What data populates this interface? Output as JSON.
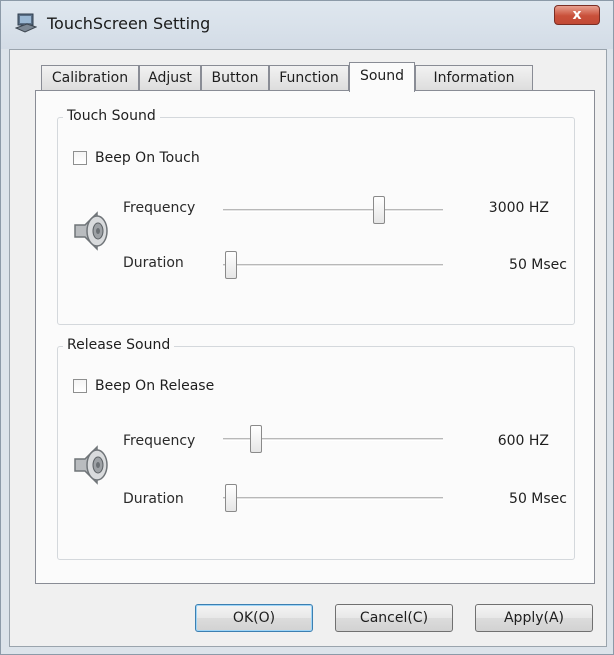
{
  "window": {
    "title": "TouchScreen Setting",
    "close_label": "x"
  },
  "tabs": [
    {
      "label": "Calibration"
    },
    {
      "label": "Adjust"
    },
    {
      "label": "Button"
    },
    {
      "label": "Function"
    },
    {
      "label": "Sound",
      "active": true
    },
    {
      "label": "Information"
    }
  ],
  "touch_sound": {
    "title": "Touch Sound",
    "beep_label": "Beep On Touch",
    "beep_checked": false,
    "frequency_label": "Frequency",
    "frequency_value": "3000 HZ",
    "frequency_level": 0.72,
    "duration_label": "Duration",
    "duration_value": "50 Msec",
    "duration_level": 0.0
  },
  "release_sound": {
    "title": "Release Sound",
    "beep_label": "Beep On Release",
    "beep_checked": false,
    "frequency_label": "Frequency",
    "frequency_value": "600 HZ",
    "frequency_level": 0.12,
    "duration_label": "Duration",
    "duration_value": "50 Msec",
    "duration_level": 0.0
  },
  "buttons": {
    "ok_label": "OK(O)",
    "cancel_label": "Cancel(C)",
    "apply_label": "Apply(A)"
  },
  "icons": {
    "app": "touchscreen-app-icon",
    "touch_speaker": "speaker-icon",
    "release_speaker": "speaker-icon"
  },
  "colors": {
    "close_button": "#c9503a",
    "default_button_border": "#3c7fb1"
  }
}
